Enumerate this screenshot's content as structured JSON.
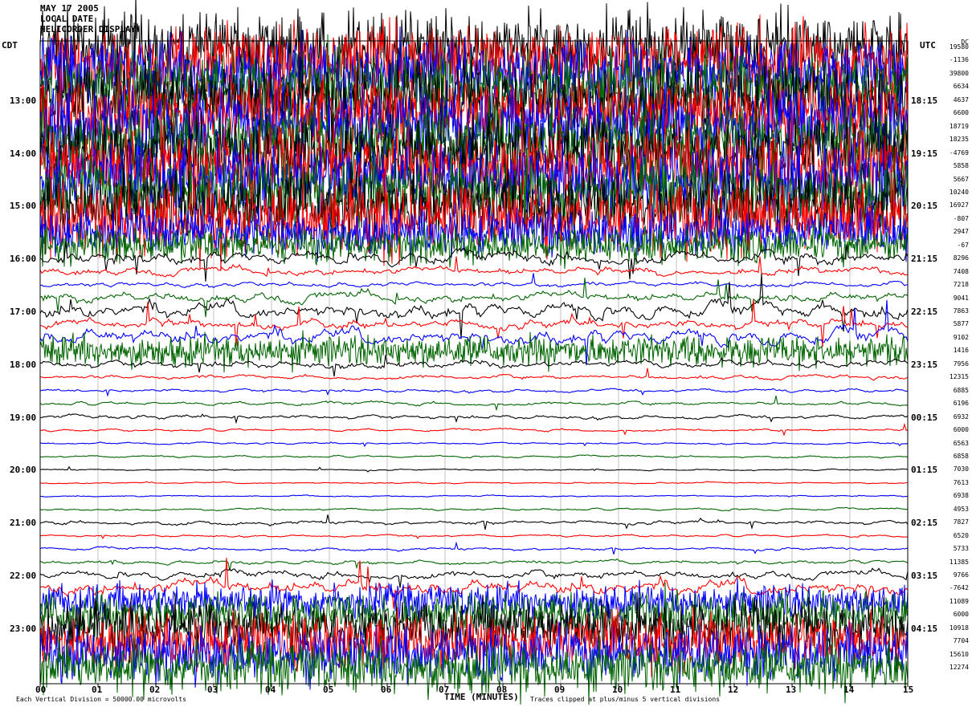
{
  "header": {
    "line1": "MAY 17 2005",
    "line2": "LOCAL DATE",
    "line3": "HELICORDER DISPLAY"
  },
  "left_axis_title": "CDT",
  "right_axis_title": "UTC",
  "offset_header": "DC",
  "footer": {
    "scale_note": "Each Vertical Division = 50000.00 microvolts",
    "xlabel": "TIME (MINUTES)",
    "clip_note": "Traces clipped at plus/minus 5 vertical divisions"
  },
  "colors": {
    "trace_cycle": [
      "#000000",
      "#ff0000",
      "#0000ff",
      "#006400"
    ],
    "grid": "#999999",
    "frame": "#000000"
  },
  "chart_data": {
    "type": "line",
    "subtype": "helicorder",
    "x_ticks": [
      "00",
      "01",
      "02",
      "03",
      "04",
      "05",
      "06",
      "07",
      "08",
      "09",
      "10",
      "11",
      "12",
      "13",
      "14",
      "15"
    ],
    "xlim": [
      0,
      15
    ],
    "xlabel": "TIME (MINUTES)",
    "traces_per_hour": 4,
    "left_hour_labels": [
      "13:00",
      "14:00",
      "15:00",
      "16:00",
      "17:00",
      "18:00",
      "19:00",
      "20:00",
      "21:00",
      "22:00",
      "23:00"
    ],
    "right_hour_labels": [
      "18:15",
      "19:15",
      "20:15",
      "21:15",
      "22:15",
      "23:15",
      "00:15",
      "01:15",
      "02:15",
      "03:15",
      "04:15"
    ],
    "left_label_trace_index": [
      4,
      8,
      12,
      16,
      20,
      24,
      28,
      32,
      36,
      40,
      44
    ],
    "dc_offsets": [
      "19580",
      "-1136",
      "39800",
      "6634",
      "4637",
      "6600",
      "18719",
      "18235",
      "-4769",
      "5858",
      "5667",
      "10240",
      "16927",
      "-807",
      "2947",
      "-67",
      "8296",
      "7408",
      "7218",
      "9041",
      "7863",
      "5877",
      "9102",
      "1416",
      "7956",
      "12315",
      "6885",
      "6196",
      "6932",
      "6000",
      "6563",
      "6858",
      "7030",
      "7613",
      "6938",
      "4953",
      "7827",
      "6520",
      "5733",
      "11385",
      "9766",
      "-7642",
      "11089",
      "6000",
      "10918",
      "7704",
      "15610",
      "12274"
    ],
    "trace_activity": [
      16,
      16,
      16,
      16,
      16,
      16,
      16,
      16,
      16,
      16,
      16,
      16,
      16,
      16,
      10,
      8,
      5,
      3,
      2,
      4,
      6,
      4,
      6,
      7,
      3,
      1.6,
      1.4,
      1.4,
      1.6,
      1,
      0.8,
      0.8,
      0.6,
      0.6,
      0.6,
      0.9,
      1.6,
      0.9,
      1.2,
      1.6,
      3,
      6,
      8,
      10,
      12,
      12,
      12,
      12
    ],
    "trace_count": 48
  }
}
